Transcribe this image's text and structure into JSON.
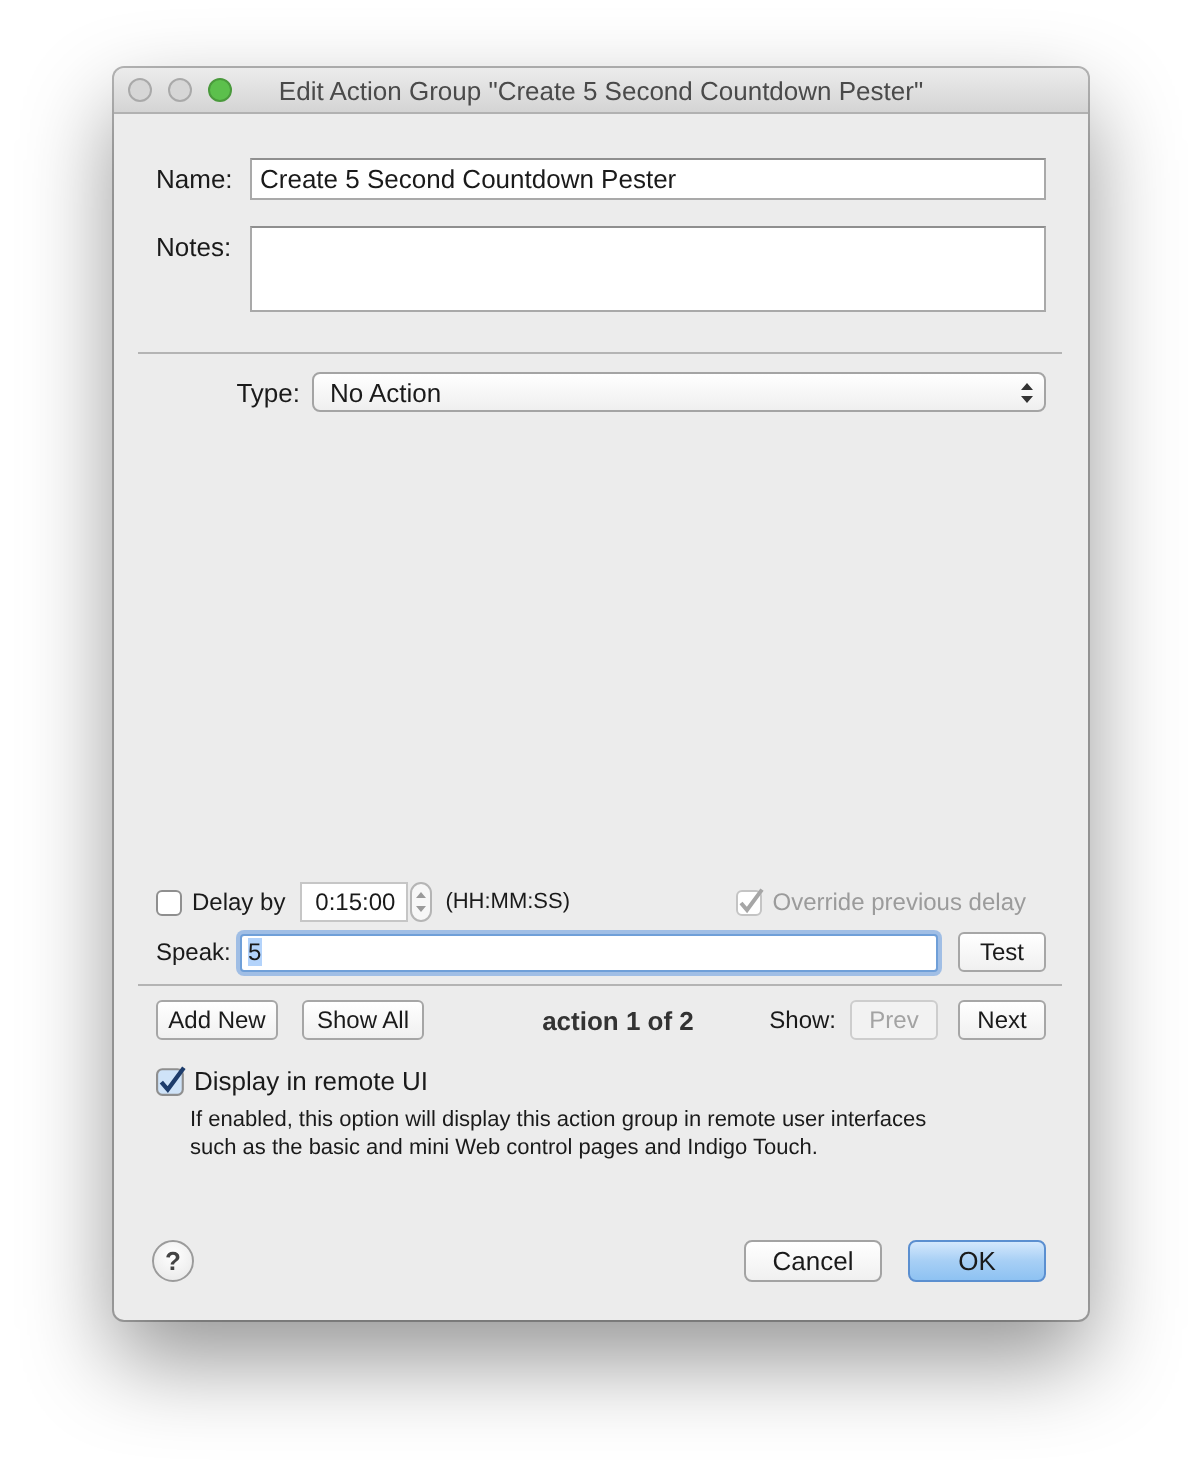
{
  "window": {
    "title": "Edit Action Group \"Create 5 Second Countdown Pester\"",
    "buttons": [
      {
        "kind": "close",
        "enabled": false
      },
      {
        "kind": "minimize",
        "enabled": false
      },
      {
        "kind": "zoom",
        "enabled": true
      }
    ]
  },
  "name": {
    "label": "Name:",
    "value": "Create 5 Second Countdown Pester"
  },
  "notes": {
    "label": "Notes:"
  },
  "type": {
    "label": "Type:",
    "value": "No Action"
  },
  "delay": {
    "checked": false,
    "label": "Delay by",
    "value": "0:15:00",
    "format": "(HH:MM:SS)"
  },
  "override_delay": {
    "checked": true,
    "disabled": true,
    "label": "Override previous delay"
  },
  "speak": {
    "label": "Speak:",
    "value": "5",
    "focused": true,
    "button": "Test"
  },
  "navigation": {
    "buttons": [
      {
        "label": "Add New"
      },
      {
        "label": "Show All"
      }
    ],
    "position": "action 1 of 2",
    "show_label": "Show:",
    "pager": [
      {
        "label": "Prev",
        "disabled": true
      },
      {
        "label": "Next",
        "disabled": false
      }
    ]
  },
  "remote_ui": {
    "checked": true,
    "label": "Display in remote UI",
    "description": "If enabled, this option will display this action group in remote user interfaces such as the basic and mini Web control pages and Indigo Touch."
  },
  "footer": {
    "help": "?",
    "buttons": [
      {
        "label": "Cancel",
        "default": false
      },
      {
        "label": "OK",
        "default": true
      }
    ]
  }
}
